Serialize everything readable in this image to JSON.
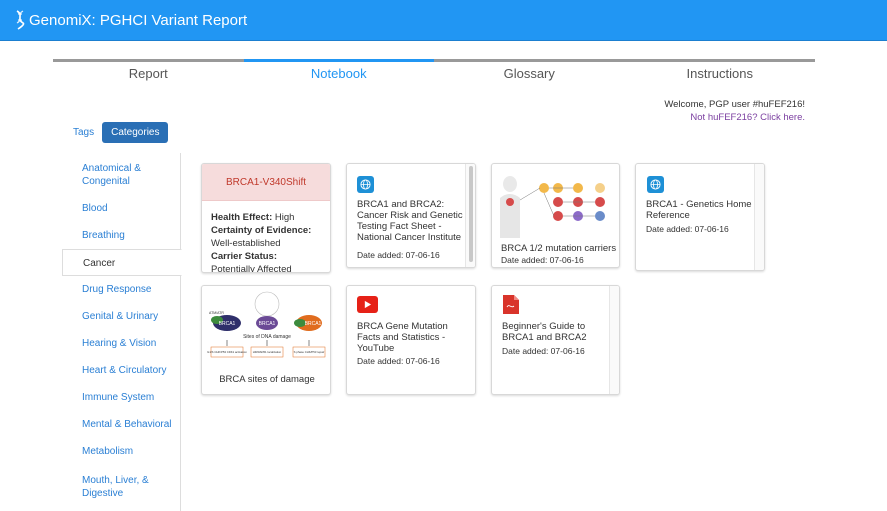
{
  "app": {
    "title": "GenomiX: PGHCI Variant Report",
    "accent": "#2196f3"
  },
  "tabs": [
    {
      "label": "Report",
      "active": false
    },
    {
      "label": "Notebook",
      "active": true
    },
    {
      "label": "Glossary",
      "active": false
    },
    {
      "label": "Instructions",
      "active": false
    }
  ],
  "welcome": {
    "line1": "Welcome, PGP user #huFEF216!",
    "line2": "Not huFEF216? Click here."
  },
  "toggle": {
    "tags": "Tags",
    "categories": "Categories"
  },
  "sidebar": {
    "items": [
      {
        "label": "Anatomical & Congenital"
      },
      {
        "label": "Blood"
      },
      {
        "label": "Breathing"
      },
      {
        "label": "Cancer",
        "active": true
      },
      {
        "label": "Drug Response"
      },
      {
        "label": "Genital & Urinary"
      },
      {
        "label": "Hearing & Vision"
      },
      {
        "label": "Heart & Circulatory"
      },
      {
        "label": "Immune System"
      },
      {
        "label": "Mental & Behavioral"
      },
      {
        "label": "Metabolism"
      },
      {
        "label": "Mouth, Liver, & Digestive"
      }
    ]
  },
  "cards": {
    "variant": {
      "name": "BRCA1-V340Shift",
      "health_effect_label": "Health Effect:",
      "health_effect": "High",
      "certainty_label": "Certainty of Evidence:",
      "certainty": "Well-established",
      "carrier_label": "Carrier Status:",
      "carrier": "Potentially Affected"
    },
    "nci": {
      "title": "BRCA1 and BRCA2: Cancer Risk and Genetic Testing Fact Sheet - National Cancer Institute",
      "date": "Date added: 07-06-16",
      "icon": "globe-icon"
    },
    "carriers": {
      "caption": "BRCA 1/2 mutation carriers",
      "date": "Date added: 07-06-16"
    },
    "ghr": {
      "title": "BRCA1 - Genetics Home Reference",
      "date": "Date added: 07-06-16",
      "icon": "globe-icon"
    },
    "damage": {
      "caption": "BRCA sites of damage",
      "diagram_mid": "Sites of DNA damage",
      "node_center": "BRCA1",
      "node_left": "BRCA1",
      "node_right": "BRCA1",
      "node_left_in": "ATM/ATR",
      "box1": "G1/S CHK/P53 CDK1 activation",
      "box2": "HR/RAD51 localization",
      "box3": "S phase CHK/P53 repair"
    },
    "youtube": {
      "title": "BRCA Gene Mutation Facts and Statistics - YouTube",
      "date": "Date added: 07-06-16",
      "icon": "youtube-icon"
    },
    "pdf": {
      "title": "Beginner's Guide to BRCA1 and BRCA2",
      "date": "Date added: 07-06-16",
      "icon": "pdf-icon"
    }
  }
}
